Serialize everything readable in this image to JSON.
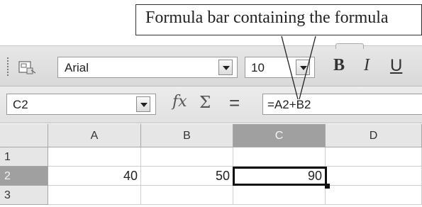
{
  "callout": {
    "text": "Formula bar containing the formula"
  },
  "toolbar": {
    "font_name": "Arial",
    "font_size": "10",
    "bold_label": "B",
    "italic_label": "I",
    "underline_label": "U"
  },
  "formula_bar": {
    "name_box": "C2",
    "fx_symbol": "fx",
    "sum_symbol": "Σ",
    "equals_symbol": "=",
    "formula": "=A2+B2"
  },
  "grid": {
    "columns": [
      "A",
      "B",
      "C",
      "D"
    ],
    "selected_column": "C",
    "rows": [
      {
        "label": "1",
        "cells": [
          "",
          "",
          "",
          ""
        ]
      },
      {
        "label": "2",
        "cells": [
          "40",
          "50",
          "90",
          ""
        ]
      },
      {
        "label": "3",
        "cells": [
          "",
          "",
          "",
          ""
        ]
      }
    ],
    "active_cell": "C2"
  }
}
